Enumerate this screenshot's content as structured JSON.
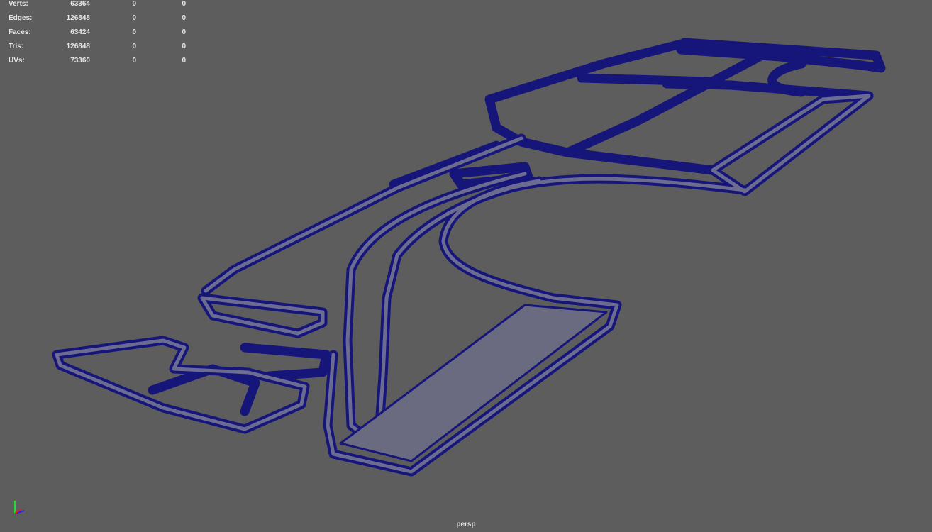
{
  "hud": {
    "rows": [
      {
        "label": "Verts:",
        "total": "63364",
        "selected": "0",
        "triangles": "0"
      },
      {
        "label": "Edges:",
        "total": "126848",
        "selected": "0",
        "triangles": "0"
      },
      {
        "label": "Faces:",
        "total": "63424",
        "selected": "0",
        "triangles": "0"
      },
      {
        "label": "Tris:",
        "total": "126848",
        "selected": "0",
        "triangles": "0"
      },
      {
        "label": "UVs:",
        "total": "73360",
        "selected": "0",
        "triangles": "0"
      }
    ]
  },
  "camera_label": "persp",
  "colors": {
    "background": "#5d5d5d",
    "wireframe": "#16167a",
    "mesh_fill": "#6a6a80"
  }
}
